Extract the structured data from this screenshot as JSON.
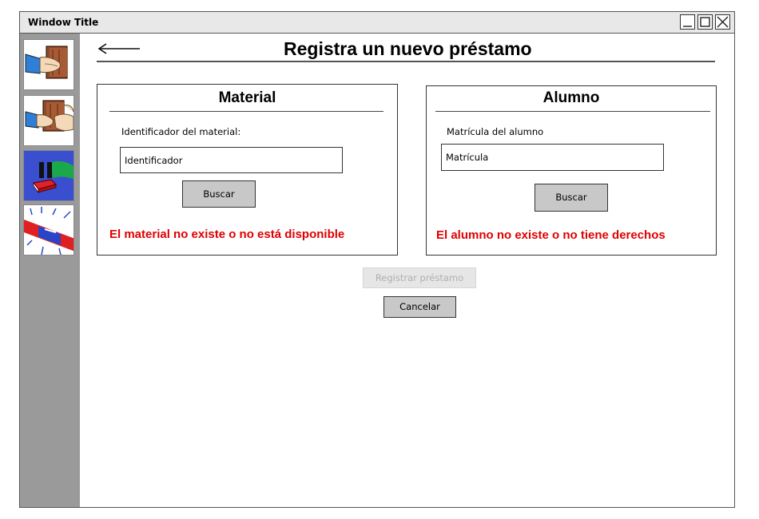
{
  "window": {
    "title": "Window Title"
  },
  "sidebar": {
    "items": [
      {
        "icon": "hand-book-icon"
      },
      {
        "icon": "hands-book-return-icon"
      },
      {
        "icon": "pause-book-icon"
      },
      {
        "icon": "alert-siren-icon"
      }
    ]
  },
  "page": {
    "title": "Registra un nuevo préstamo"
  },
  "material": {
    "heading": "Material",
    "label": "Identificador del material:",
    "input_value": "Identificador",
    "search_label": "Buscar",
    "error": "El material no existe o no está disponible"
  },
  "alumno": {
    "heading": "Alumno",
    "label": "Matrícula del alumno",
    "input_value": "Matrícula",
    "search_label": "Buscar",
    "error": "El alumno no existe o no tiene derechos"
  },
  "actions": {
    "register_label": "Registrar préstamo",
    "cancel_label": "Cancelar"
  },
  "colors": {
    "error": "#e00000",
    "sidebar": "#9a9a9a",
    "button": "#c8c8c8"
  }
}
